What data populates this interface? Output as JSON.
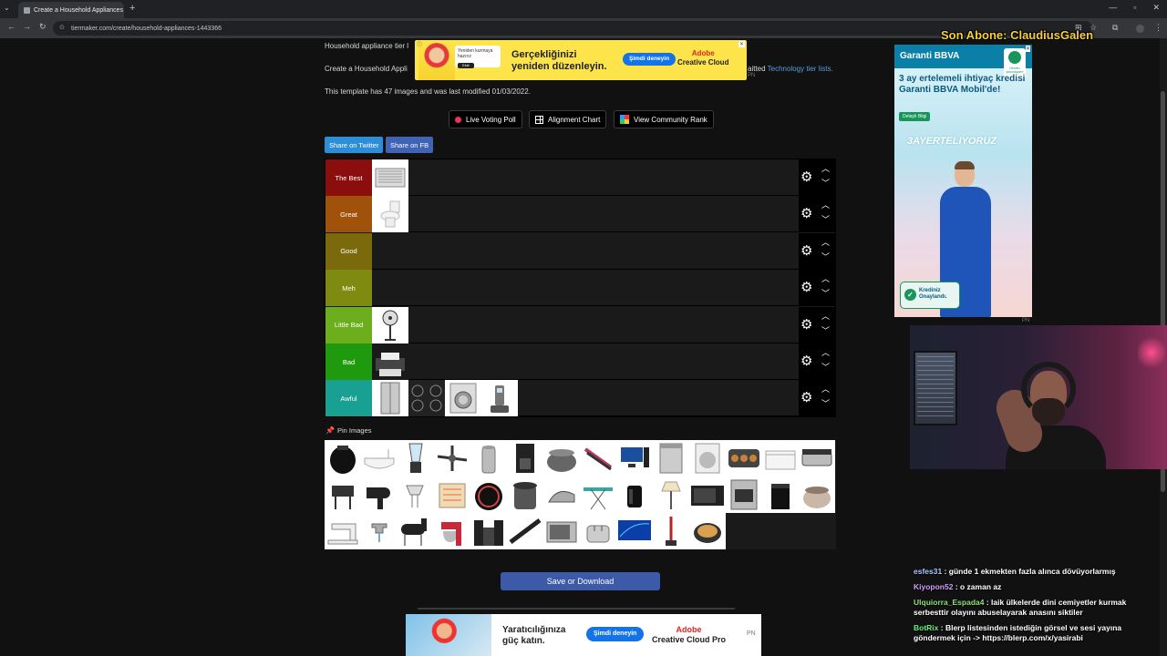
{
  "browser": {
    "tab_title": "Create a Household Appliances",
    "tab_close": "✕",
    "new_tab": "+",
    "url": "tiermaker.com/create/household-appliances-1443366"
  },
  "page": {
    "intro_line1": "Household appliance tier l",
    "intro_line2_start": "Create a Household Appli",
    "intro_line2_end": "aitted",
    "intro_link": "Technology tier lists.",
    "intro_pn": "PN",
    "template_info": "This template has 47 images and was last modified 01/03/2022.",
    "buttons": {
      "live_voting": "Live Voting Poll",
      "alignment_chart": "Alignment Chart",
      "community_rank": "View Community Rank"
    },
    "share": {
      "twitter": "Share on Twitter",
      "fb": "Share on FB"
    },
    "tiers": [
      {
        "label": "The Best",
        "color": "#8b0d0d",
        "items": [
          "air-conditioner"
        ]
      },
      {
        "label": "Great",
        "color": "#a0520a",
        "items": [
          "toilet"
        ]
      },
      {
        "label": "Good",
        "color": "#7a6a0b",
        "items": []
      },
      {
        "label": "Meh",
        "color": "#7e8a10",
        "items": []
      },
      {
        "label": "Little Bad",
        "color": "#6cae1b",
        "items": [
          "standing-fan"
        ]
      },
      {
        "label": "Bad",
        "color": "#1f9a0e",
        "items": [
          "printer"
        ]
      },
      {
        "label": "Awful",
        "color": "#18a092",
        "items": [
          "refrigerator",
          "gas-stove",
          "washing-machine",
          "cordless-phone"
        ]
      }
    ],
    "pin_images": "Pin Images",
    "save_download": "Save or Download"
  },
  "ads": {
    "top": {
      "card_text": "Yeniden kurmaya hazırız",
      "card_button": "Ekle",
      "headline": "Gerçekliğinizi\nyeniden düzenleyin.",
      "cta": "Şimdi deneyin",
      "brand_name": "Adobe",
      "brand_product": "Creative Cloud"
    },
    "right": {
      "bank": "Garanti BBVA",
      "logo_text": "Hemen yolundayım!",
      "headline": "3 ay ertelemeli ihtiyaç kredisi Garanti BBVA Mobil'de!",
      "detail": "Detaylı Bilgi",
      "slogan": "3AYERTELIYORUZ",
      "badge": "Krediniz Onaylandı.",
      "pn": "PN"
    },
    "bottom": {
      "headline": "Yaratıcılığınıza\ngüç katın.",
      "cta": "Şimdi deneyin",
      "brand_name": "Adobe",
      "brand_product": "Creative Cloud Pro",
      "pn": "PN"
    }
  },
  "overlay": {
    "son_abone": "Son Abone: ClaudiusGalen"
  },
  "chat": [
    {
      "user": "esfes31",
      "color": "#a9c7ff",
      "text": ": günde 1 ekmekten fazla alınca dövüyorlarmış"
    },
    {
      "user": "Kiyopon52",
      "color": "#d59cff",
      "text": ": o zaman az"
    },
    {
      "user": "Ulquiorra_Espada4",
      "color": "#8fe07a",
      "text": ": laik ülkelerde dini cemiyetler kurmak serbesttir olayını abuselayarak anasını siktiler"
    },
    {
      "user": "BotRix",
      "color": "#6cf07a",
      "text": ": Blerp listesinden istediğin görsel ve sesi yayına göndermek için -> https://blerp.com/x/yasirabi"
    }
  ]
}
